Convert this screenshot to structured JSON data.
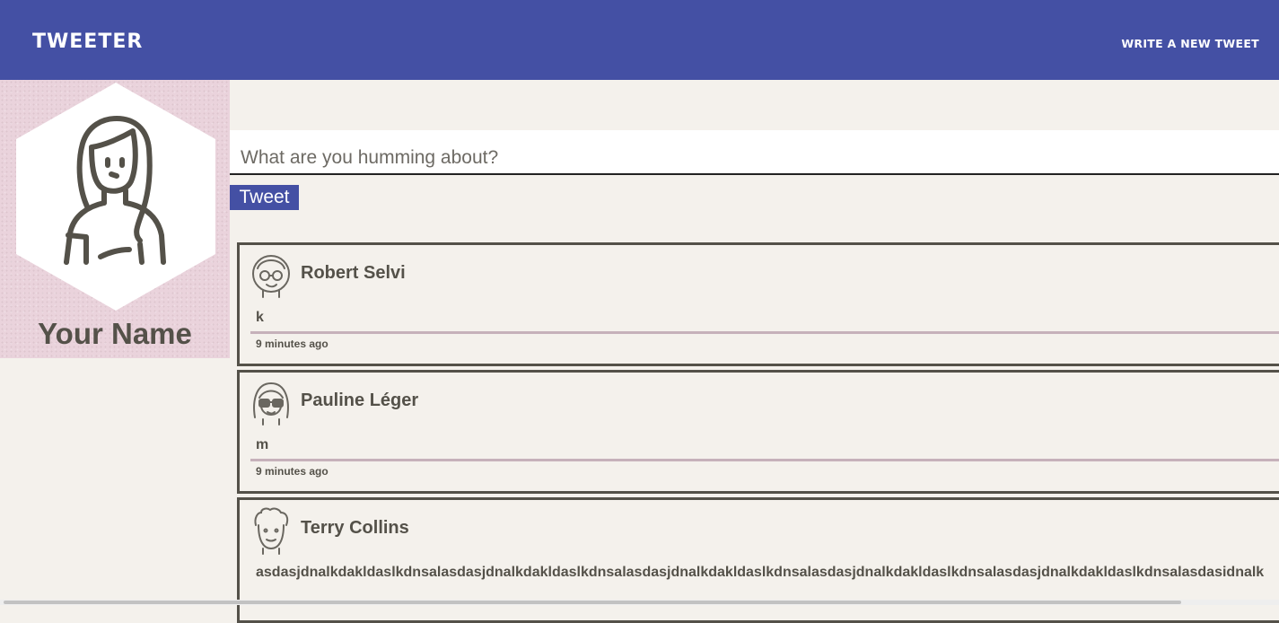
{
  "nav": {
    "brand": "TWEETER",
    "compose_link": "WRITE A NEW TWEET"
  },
  "profile": {
    "name": "Your Name",
    "avatar_icon": "female-avatar-icon"
  },
  "composer": {
    "placeholder": "What are you humming about?",
    "value": "",
    "submit_label": "Tweet"
  },
  "tweets": [
    {
      "author": "Robert Selvi",
      "avatar_icon": "glasses-man-avatar-icon",
      "body": "k",
      "time": "9 minutes ago"
    },
    {
      "author": "Pauline Léger",
      "avatar_icon": "sunglasses-woman-avatar-icon",
      "body": "m",
      "time": "9 minutes ago"
    },
    {
      "author": "Terry Collins",
      "avatar_icon": "curly-hair-man-avatar-icon",
      "body": "asdasjdnalkdakldaslkdnsalasdasjdnalkdakldaslkdnsalasdasjdnalkdakldaslkdnsalasdasjdnalkdakldaslkdnsalasdasjdnalkdakldaslkdnsalasdasidnalk",
      "time": ""
    }
  ],
  "colors": {
    "nav_bg": "#4450a4",
    "profile_bg": "#ead3dc",
    "page_bg": "#f4f1ec",
    "text": "#545149",
    "divider": "#c6b1ba"
  }
}
